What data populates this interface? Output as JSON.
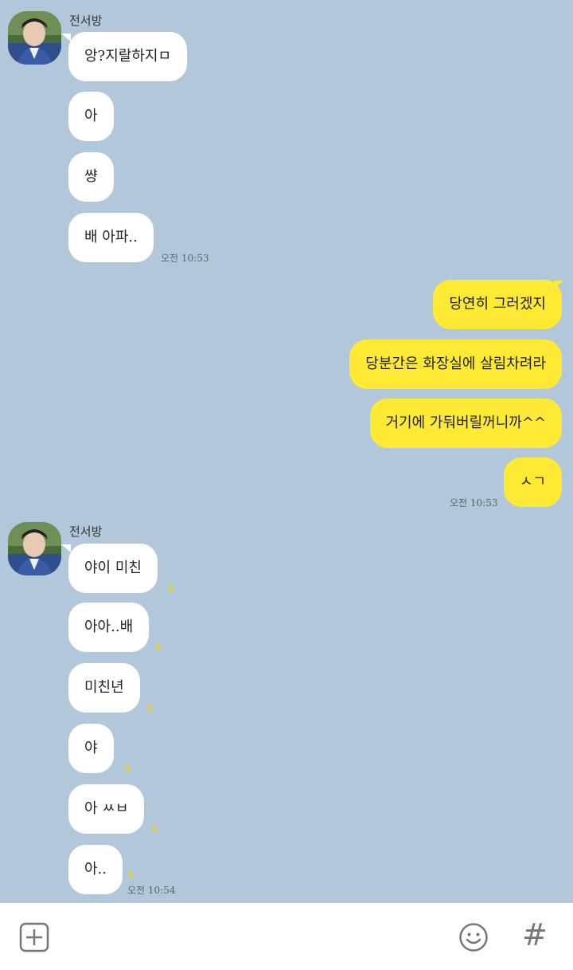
{
  "chat": {
    "groups": [
      {
        "sender": "전서방",
        "messages": [
          "앙?지랄하지ㅁ",
          "아",
          "썅",
          "배 아파.."
        ],
        "time": "오전 10:53"
      },
      {
        "messages_me": [
          "당연히 그러겠지",
          "당분간은 화장실에 살림차려라",
          "거기에 가둬버릴꺼니까^^",
          "ㅅㄱ"
        ],
        "time": "오전 10:53"
      },
      {
        "sender": "전서방",
        "messages": [
          "야이 미친",
          "아아..배",
          "미친년",
          "야",
          "아 ㅆㅂ",
          "아.."
        ],
        "unread": [
          "1",
          "1",
          "1",
          "1",
          "1",
          "1"
        ],
        "time": "오전 10:54"
      }
    ]
  },
  "input_bar": {
    "plus_icon": "plus-box-icon",
    "emoji_icon": "smiley-icon",
    "hash_label": "#"
  },
  "colors": {
    "background": "#b2c7da",
    "incoming_bubble": "#ffffff",
    "outgoing_bubble": "#fee934",
    "unread": "#f4d100"
  }
}
